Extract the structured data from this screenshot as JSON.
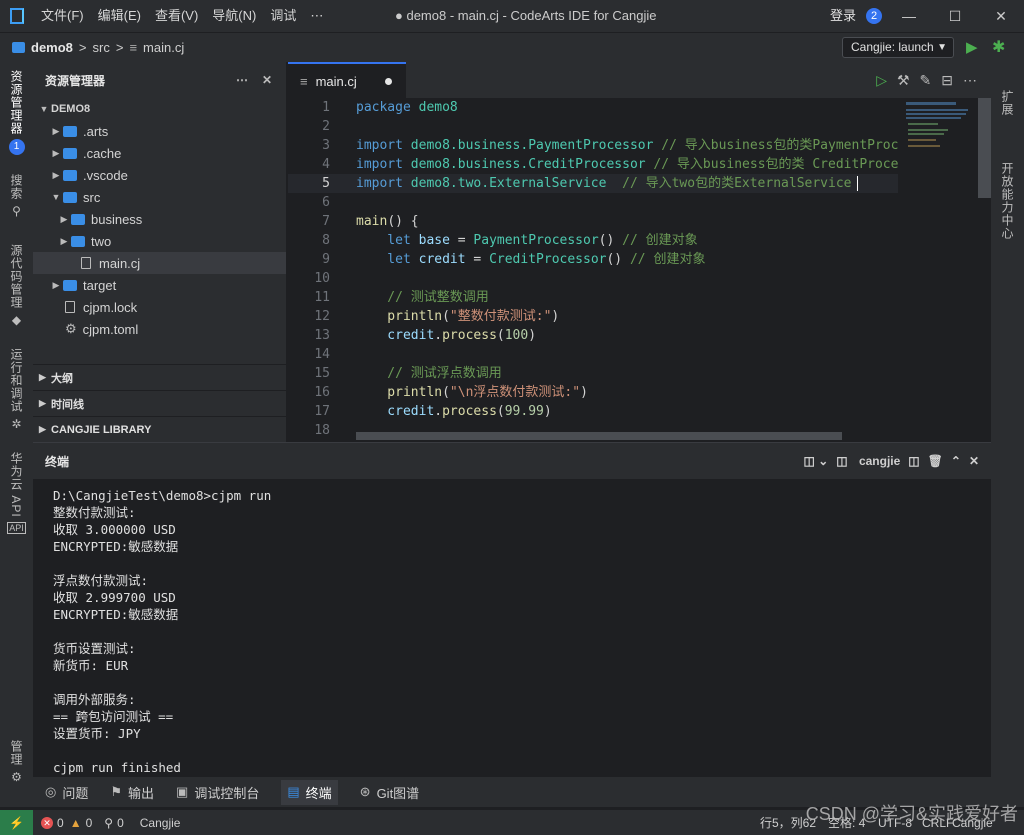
{
  "window": {
    "menu": [
      "文件(F)",
      "编辑(E)",
      "查看(V)",
      "导航(N)",
      "调试",
      "⋯"
    ],
    "title": "● demo8 - main.cj - CodeArts IDE for Cangjie",
    "login": "登录",
    "notif_count": "2"
  },
  "breadcrumb": {
    "project": "demo8",
    "sep1": ">",
    "folder": "src",
    "sep2": ">",
    "file": "main.cj"
  },
  "run_config": {
    "label": "Cangjie: launch"
  },
  "activity": {
    "explorer": "资源管理器",
    "explorer_badge": "1",
    "search": "搜索",
    "scm": "源代码管理",
    "run_debug": "运行和调试",
    "api": "华为云 API",
    "manage": "管理"
  },
  "rightbar": {
    "extensions": "扩展",
    "dev_center": "开放能力中心"
  },
  "explorer": {
    "title": "资源管理器",
    "root": "DEMO8",
    "items": [
      {
        "label": ".arts"
      },
      {
        "label": ".cache"
      },
      {
        "label": ".vscode"
      },
      {
        "label": "src"
      },
      {
        "label": "business"
      },
      {
        "label": "two"
      },
      {
        "label": "main.cj"
      },
      {
        "label": "target"
      },
      {
        "label": "cjpm.lock"
      },
      {
        "label": "cjpm.toml"
      }
    ],
    "sections": [
      "大纲",
      "时间线",
      "CANGJIE LIBRARY"
    ]
  },
  "editor": {
    "tab": "main.cj",
    "lines": [
      "1",
      "2",
      "3",
      "4",
      "5",
      "6",
      "7",
      "8",
      "9",
      "10",
      "11",
      "12",
      "13",
      "14",
      "15",
      "16",
      "17",
      "18"
    ],
    "code": {
      "l1_kw": "package",
      "l1_id": " demo8",
      "l3_kw": "import",
      "l3_a": " demo8.business.",
      "l3_b": "PaymentProcessor",
      "l3_c": " // 导入business包的类PaymentProce",
      "l4_kw": "import",
      "l4_a": " demo8.business.",
      "l4_b": "CreditProcessor",
      "l4_c": " // 导入business包的类 CreditProces",
      "l5_kw": "import",
      "l5_a": " demo8.two.",
      "l5_b": "ExternalService",
      "l5_c": "  // 导入two包的类ExternalService",
      "l7_fn": "main",
      "l7_p": "() {",
      "l8_kw": "    let",
      "l8_id": " base",
      "l8_p": " = ",
      "l8_cl": "PaymentProcessor",
      "l8_p2": "()",
      "l8_c": " // 创建对象",
      "l9_kw": "    let",
      "l9_id": " credit",
      "l9_p": " = ",
      "l9_cl": "CreditProcessor",
      "l9_p2": "()",
      "l9_c": " // 创建对象",
      "l11_c": "    // 测试整数调用",
      "l12_fn": "    println",
      "l12_p": "(",
      "l12_s": "\"整数付款测试:\"",
      "l12_p2": ")",
      "l13_id": "    credit",
      "l13_p": ".",
      "l13_fn": "process",
      "l13_p2": "(",
      "l13_n": "100",
      "l13_p3": ")",
      "l15_c": "    // 测试浮点数调用",
      "l16_fn": "    println",
      "l16_p": "(",
      "l16_s": "\"\\n浮点数付款测试:\"",
      "l16_p2": ")",
      "l17_id": "    credit",
      "l17_p": ".",
      "l17_fn": "process",
      "l17_p2": "(",
      "l17_n": "99.99",
      "l17_p3": ")"
    }
  },
  "terminal": {
    "title": "终端",
    "shell": "cangjie",
    "output": "D:\\CangjieTest\\demo8>cjpm run\n整数付款测试:\n收取 3.000000 USD\nENCRYPTED:敏感数据\n\n浮点数付款测试:\n收取 2.999700 USD\nENCRYPTED:敏感数据\n\n货币设置测试:\n新货币: EUR\n\n调用外部服务:\n== 跨包访问测试 ==\n设置货币: JPY\n\ncjpm run finished"
  },
  "panel_tabs": [
    "问题",
    "输出",
    "调试控制台",
    "终端",
    "Git图谱"
  ],
  "status": {
    "errors": "0",
    "warnings": "0",
    "ports": "0",
    "lang": "Cangjie",
    "position": "行5，列62",
    "spaces": "空格: 4",
    "encoding": "UTF-8",
    "eol": "CRLF",
    "mode": "Cangjie",
    "watermark": "CSDN @学习&实践爱好者"
  },
  "colors": {
    "accent": "#3574f0",
    "run_green": "#4caf50",
    "keyword": "#569cd6",
    "class": "#4ec9b0",
    "comment": "#6a9955"
  }
}
